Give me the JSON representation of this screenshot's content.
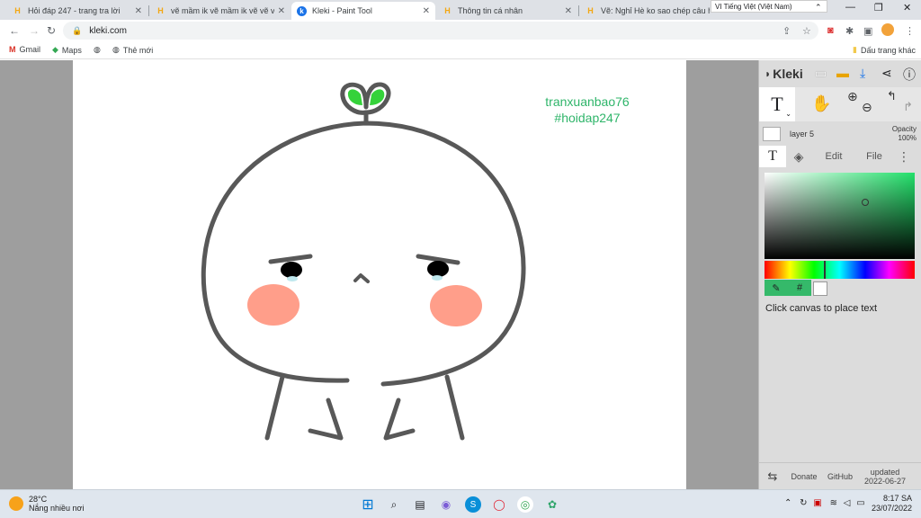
{
  "browser": {
    "tabs": [
      {
        "title": "Hỏi đáp 247 - trang tra lời",
        "favicon": "hoidap-h-icon",
        "active": false
      },
      {
        "title": "vẽ mầm ik vẽ mầm ik vẽ vẽ vẽ",
        "favicon": "hoidap-h-icon",
        "active": false
      },
      {
        "title": "Kleki - Paint Tool",
        "favicon": "kleki-icon",
        "active": true
      },
      {
        "title": "Thông tin cá nhân",
        "favicon": "hoidap-h-icon",
        "active": false
      },
      {
        "title": "Vẽ: Nghỉ Hè ko sao chép câu hỏi",
        "favicon": "hoidap-h-icon",
        "active": false
      }
    ],
    "language_popup": "VI  Tiếng Việt (Việt Nam)",
    "url": "kleki.com",
    "bookmarks": [
      {
        "label": "Gmail",
        "icon": "gmail-icon"
      },
      {
        "label": "Maps",
        "icon": "maps-icon"
      },
      {
        "label": "",
        "icon": "globe-icon"
      },
      {
        "label": "Thẻ mới",
        "icon": "globe-icon"
      }
    ],
    "other_bookmarks": "Dấu trang khác"
  },
  "canvas": {
    "watermark_line1": "tranxuanbao76",
    "watermark_line2": "#hoidap247",
    "watermark_color": "#2fb56a"
  },
  "kleki": {
    "logo": "Kleki",
    "active_tool": "T",
    "layer_name": "layer 5",
    "opacity_label": "Opacity",
    "opacity_value": "100%",
    "tab_text": "T",
    "tab_edit": "Edit",
    "tab_file": "File",
    "hex_label": "#",
    "hint": "Click canvas to place text",
    "selected_color": "#22e06a",
    "donate": "Donate",
    "github": "GitHub",
    "updated_label": "updated",
    "updated_date": "2022-06-27"
  },
  "taskbar": {
    "temperature": "28°C",
    "weather": "Nắng nhiều nơi",
    "time": "8:17 SA",
    "date": "23/07/2022"
  }
}
